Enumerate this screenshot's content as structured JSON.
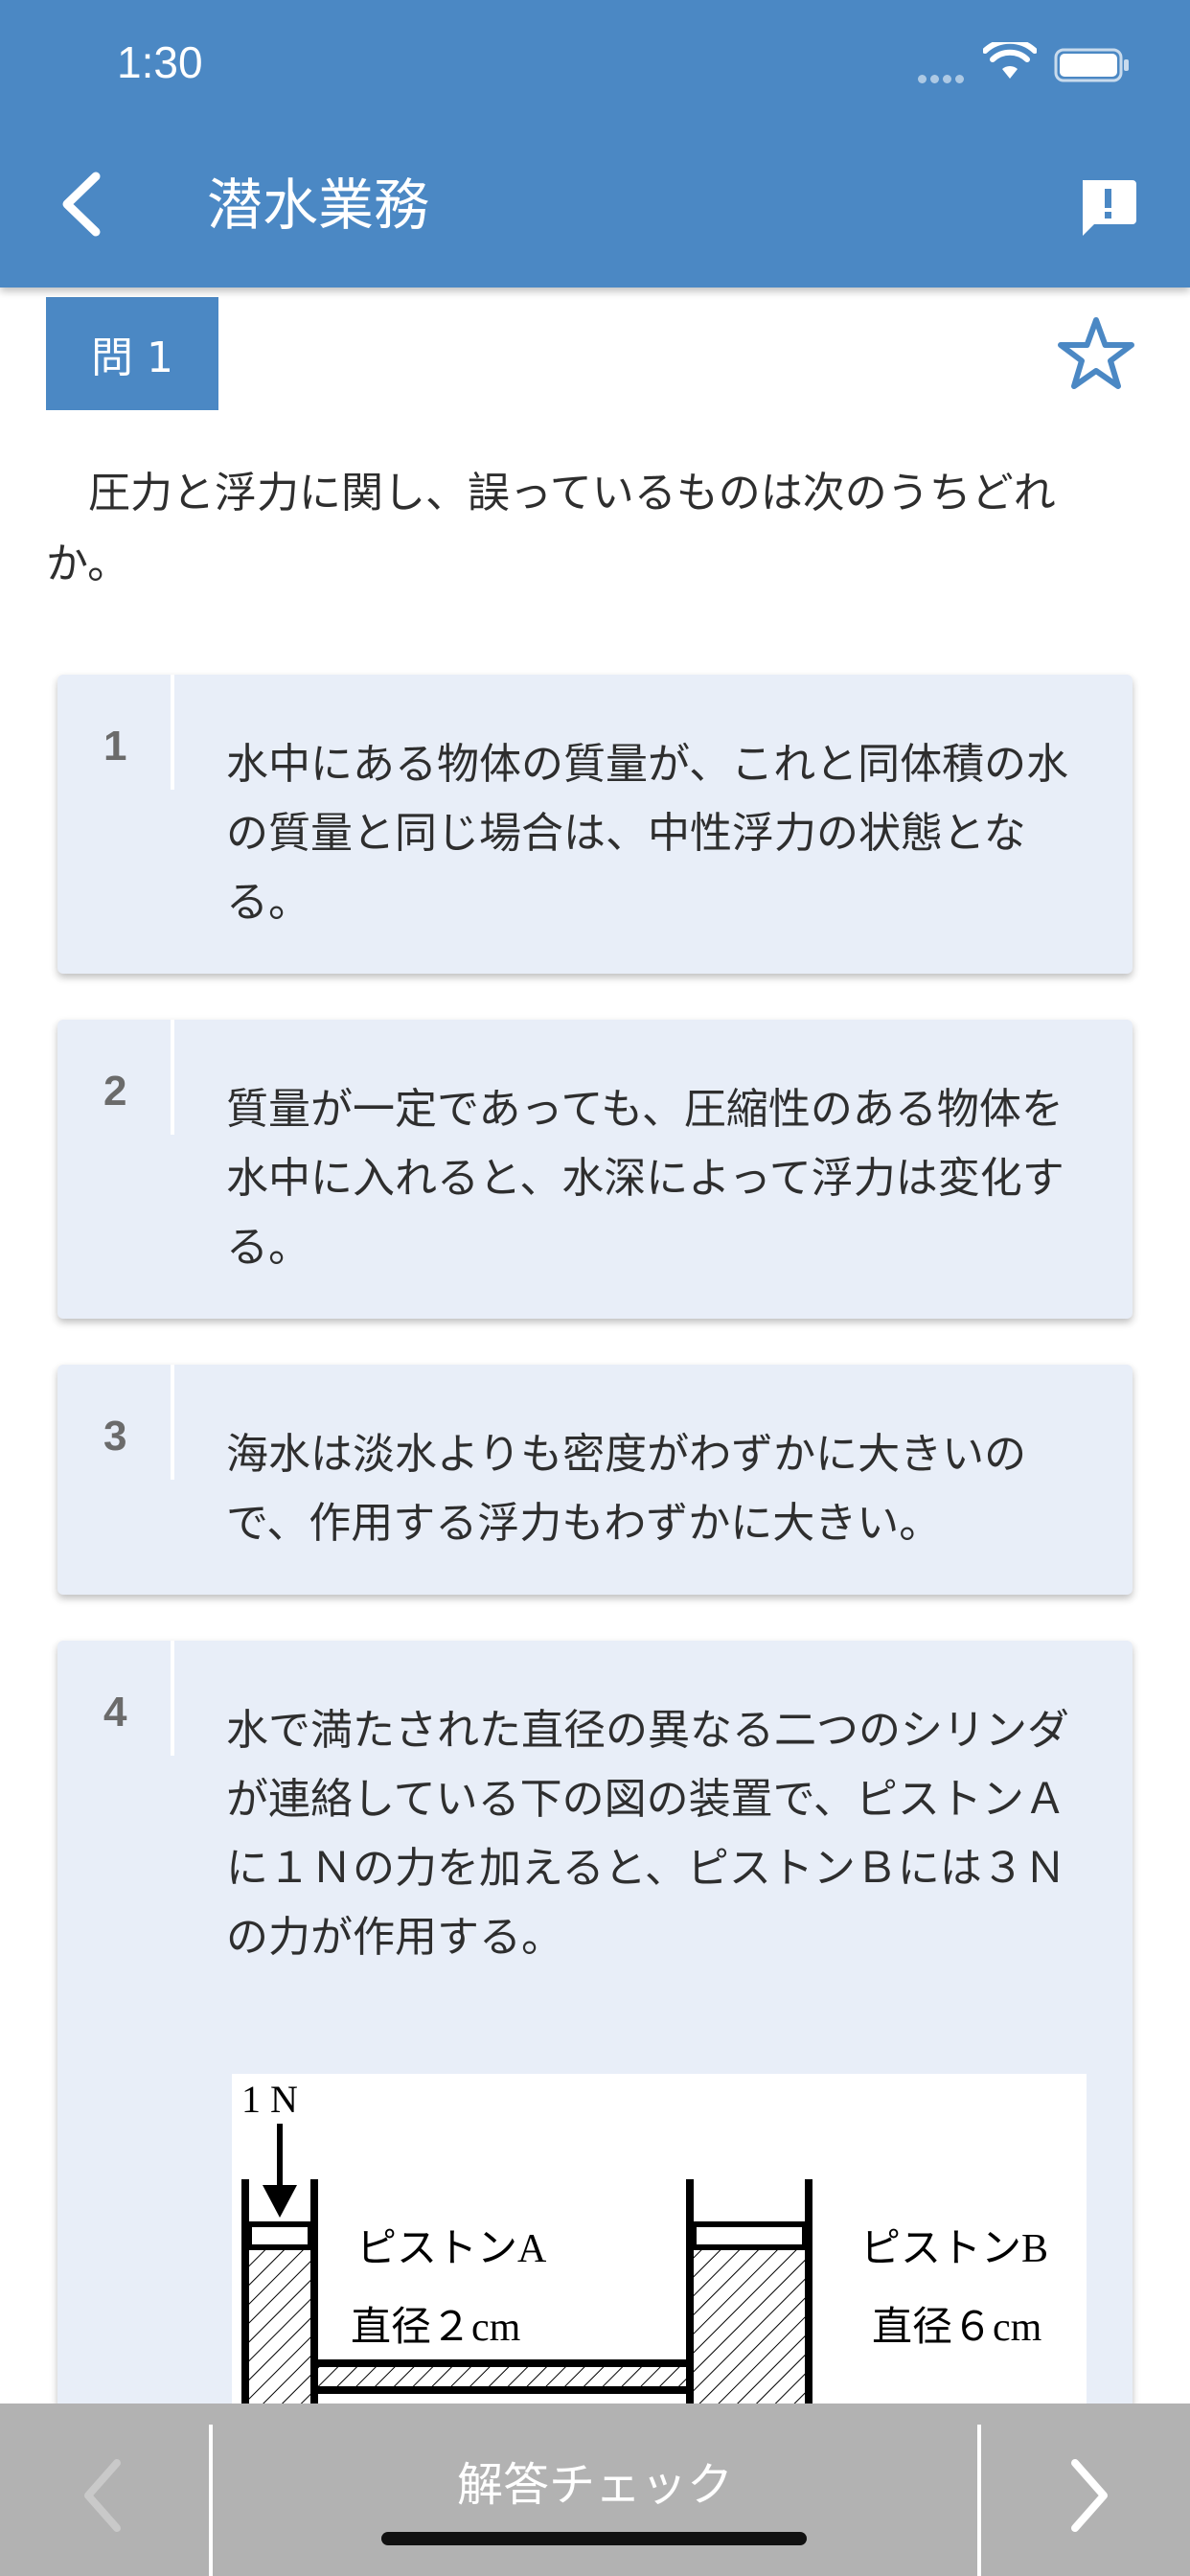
{
  "status_bar": {
    "time": "1:30"
  },
  "nav": {
    "title": "潜水業務",
    "back_icon": "chevron-left-icon",
    "report_icon": "report-icon"
  },
  "question": {
    "label": "問 1",
    "text": "　圧力と浮力に関し、誤っているものは次のうちどれか。"
  },
  "choices": [
    {
      "number": "1",
      "text": "水中にある物体の質量が、これと同体積の水の質量と同じ場合は、中性浮力の状態となる。"
    },
    {
      "number": "2",
      "text": "質量が一定であっても、圧縮性のある物体を水中に入れると、水深によって浮力は変化する。"
    },
    {
      "number": "3",
      "text": "海水は淡水よりも密度がわずかに大きいので、作用する浮力もわずかに大きい。"
    },
    {
      "number": "4",
      "text": "水で満たされた直径の異なる二つのシリンダが連絡している下の図の装置で、ピストンＡに１Ｎの力を加えると、ピストンＢには３Ｎの力が作用する。"
    }
  ],
  "diagram": {
    "force_label": "1 N",
    "piston_a_label": "ピストンA",
    "piston_a_diameter": "直径２cm",
    "piston_b_label": "ピストンB",
    "piston_b_diameter": "直径６cm"
  },
  "bottom_bar": {
    "check_label": "解答チェック"
  },
  "colors": {
    "primary": "#4b88c4",
    "card_bg": "#e8eef8",
    "bottom_bar": "#b2b2b2"
  }
}
